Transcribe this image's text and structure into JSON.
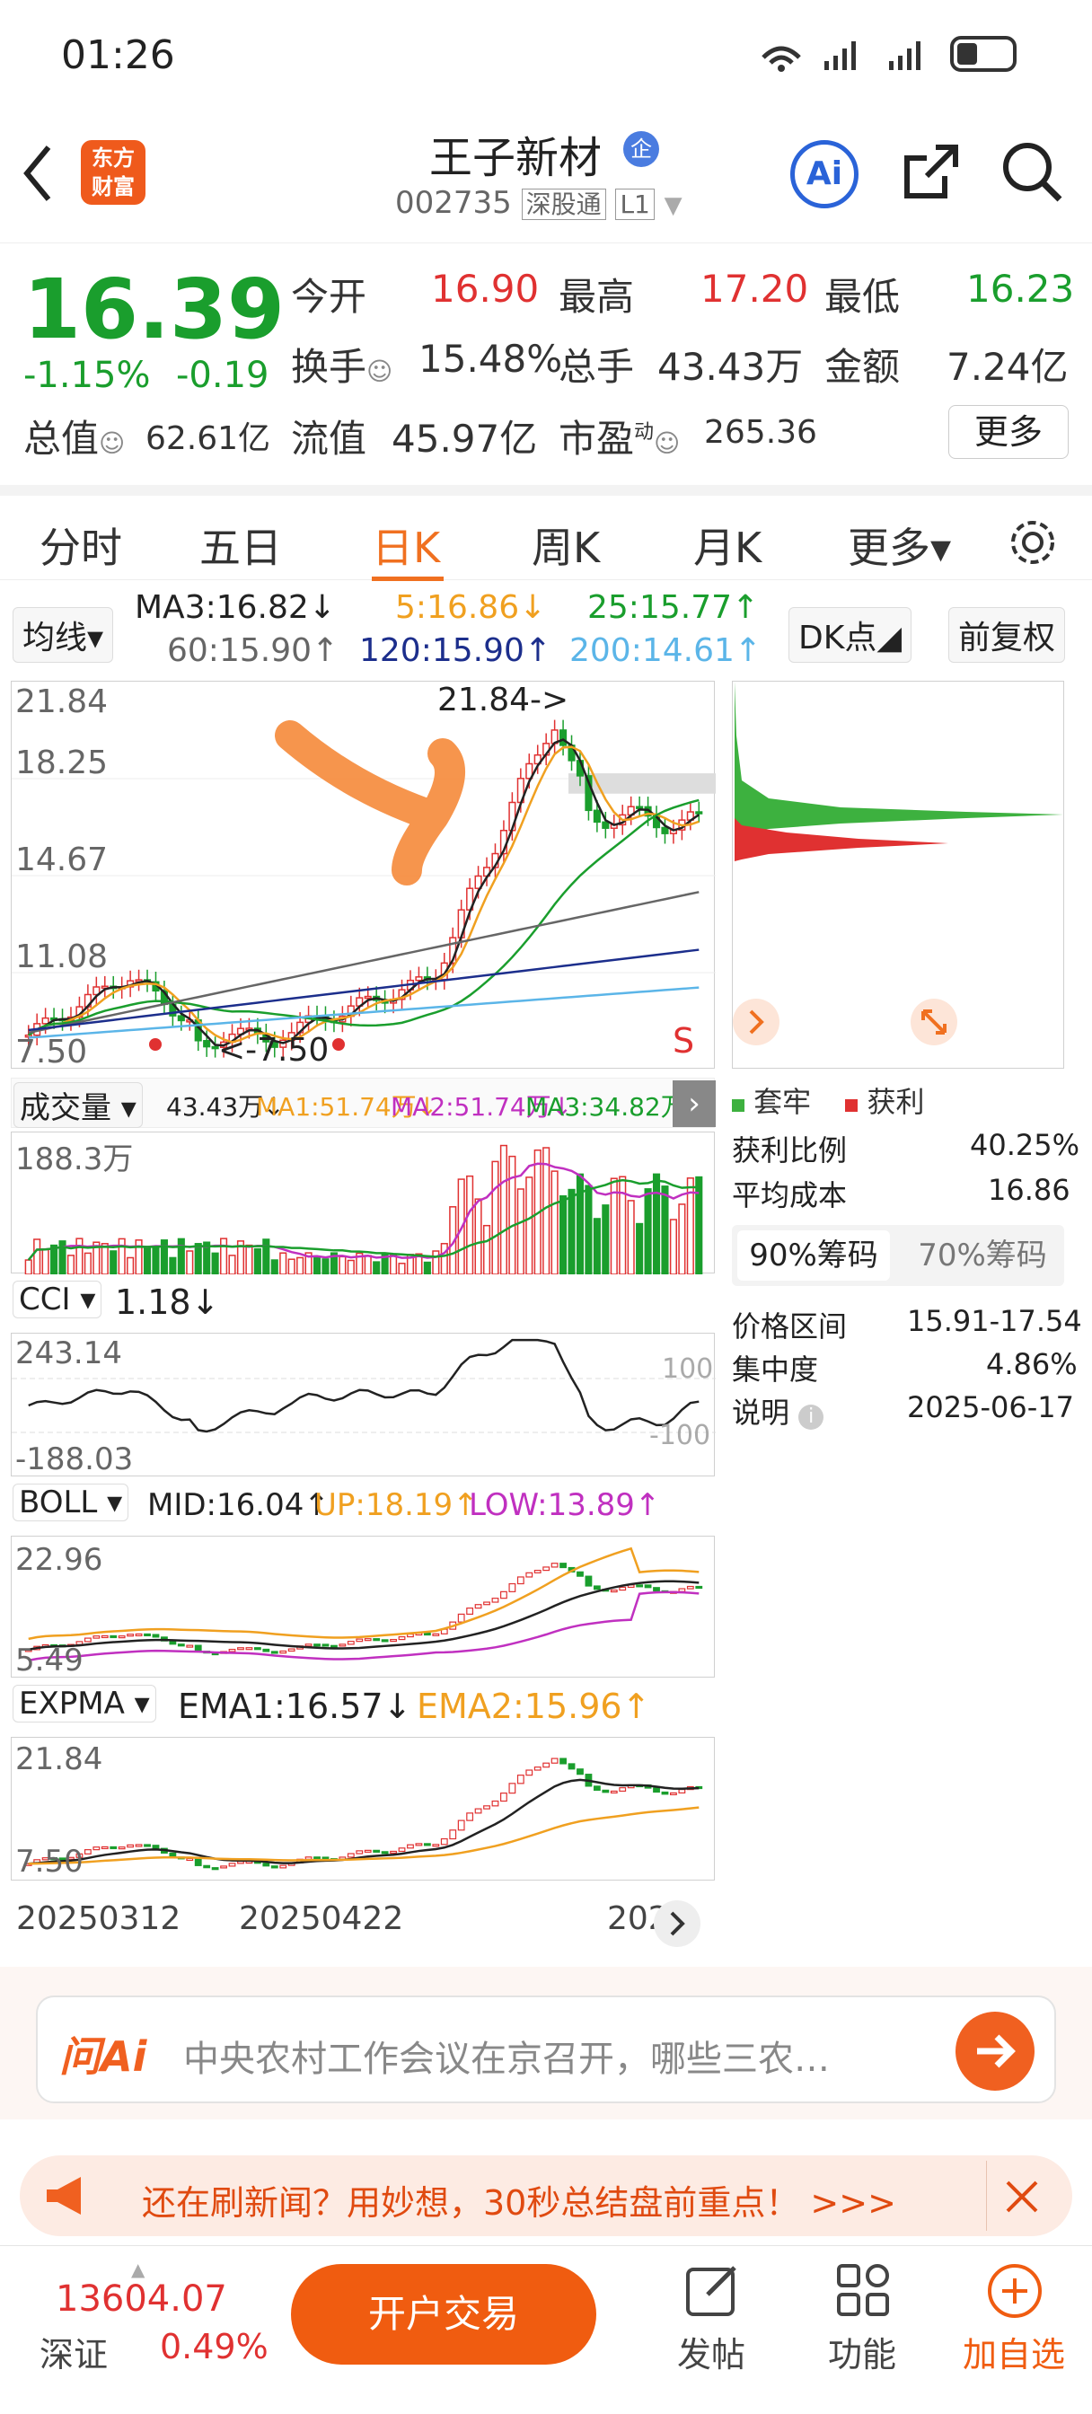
{
  "status_bar": {
    "time": "01:26"
  },
  "header": {
    "logo_line1": "东方",
    "logo_line2": "财富",
    "stock_name": "王子新材",
    "badge": "企",
    "code": "002735",
    "market": "深股通",
    "level": "L1",
    "ai_label": "Ai"
  },
  "quote": {
    "price": "16.39",
    "change_pct": "-1.15%",
    "change": "-0.19",
    "open_label": "今开",
    "open": "16.90",
    "high_label": "最高",
    "high": "17.20",
    "low_label": "最低",
    "low": "16.23",
    "turnover_label": "换手",
    "turnover": "15.48%",
    "volume_label": "总手",
    "volume": "43.43万",
    "amount_label": "金额",
    "amount": "7.24亿",
    "mcap_label": "总值",
    "mcap": "62.61亿",
    "float_label": "流值",
    "float": "45.97亿",
    "pe_label": "市盈",
    "pe_sup": "动",
    "pe": "265.36",
    "more_label": "更多"
  },
  "tabs": [
    {
      "label": "分时"
    },
    {
      "label": "五日"
    },
    {
      "label": "日K"
    },
    {
      "label": "周K"
    },
    {
      "label": "月K"
    },
    {
      "label": "更多▾"
    }
  ],
  "ma_row": {
    "selector": "均线",
    "ma3": "MA3:16.82↓",
    "ma5": "5:16.86↓",
    "ma25": "25:15.77↑",
    "ma60": "60:15.90↑",
    "ma120": "120:15.90↑",
    "ma200": "200:14.61↑",
    "dk": "DK点",
    "adjust": "前复权"
  },
  "main_chart": {
    "y_labels": [
      "21.84",
      "18.25",
      "14.67",
      "11.08",
      "7.50"
    ],
    "high_marker": "21.84->",
    "low_marker": "<-7.50",
    "s_marker": "S"
  },
  "volume": {
    "selector": "成交量",
    "vol": "43.43万↓",
    "ma1": "MA1:51.74万↓",
    "ma2": "MA2:51.74万↓",
    "ma3": "MA3:34.82万↑",
    "ymax": "188.3万"
  },
  "cci": {
    "selector": "CCI",
    "value": "1.18↓",
    "ymax": "243.14",
    "ymin": "-188.03",
    "ref_hi": "100",
    "ref_lo": "-100"
  },
  "boll": {
    "selector": "BOLL",
    "mid": "MID:16.04↑",
    "up": "UP:18.19↑",
    "low": "LOW:13.89↑",
    "ymax": "22.96",
    "ymin": "5.49"
  },
  "expma": {
    "selector": "EXPMA",
    "ema1": "EMA1:16.57↓",
    "ema2": "EMA2:15.96↑",
    "ymax": "21.84",
    "ymin": "7.50"
  },
  "dates": [
    "20250312",
    "20250422",
    "202"
  ],
  "chip_panel": {
    "legend_trap": "套牢",
    "legend_profit": "获利",
    "profit_ratio_label": "获利比例",
    "profit_ratio": "40.25%",
    "avg_cost_label": "平均成本",
    "avg_cost": "16.86",
    "tab90": "90%筹码",
    "tab70": "70%筹码",
    "range_label": "价格区间",
    "range": "15.91-17.54",
    "conc_label": "集中度",
    "conc": "4.86%",
    "note_label": "说明",
    "note_date": "2025-06-17"
  },
  "ai_bar": {
    "brand": "问Ai",
    "placeholder": "中央农村工作会议在京召开，哪些三农…"
  },
  "banner": {
    "text": "还在刷新闻？用妙想，30秒总结盘前重点！ >>>"
  },
  "bottom": {
    "index_value": "13604.07",
    "index_name": "深证",
    "index_pct": "0.49%",
    "trade": "开户交易",
    "post": "发帖",
    "func": "功能",
    "watch": "加自选"
  },
  "chart_data": {
    "type": "candlestick",
    "y_axis_labels": [
      21.84,
      18.25,
      14.67,
      11.08,
      7.5
    ],
    "price_range": [
      7.5,
      21.84
    ],
    "x_labels": [
      "20250312",
      "20250422"
    ],
    "colors": {
      "up": "#e03131",
      "down": "#1a9e2d",
      "ma3": "#222222",
      "ma5": "#f0a020",
      "ma25": "#1a9e2d",
      "ma60": "#666666",
      "ma120": "#1c2e8c",
      "ma200": "#5bb5e8"
    }
  }
}
